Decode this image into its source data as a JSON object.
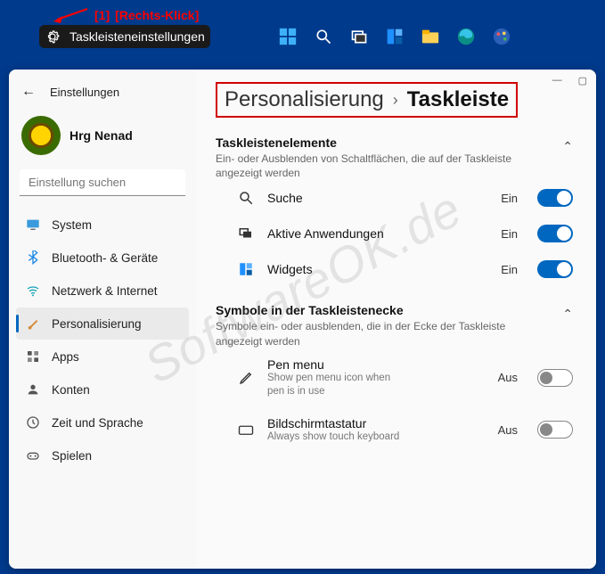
{
  "annotation": {
    "index": "[1]",
    "text": "[Rechts-Klick]"
  },
  "context_menu": {
    "label": "Taskleisteneinstellungen"
  },
  "sidebar": {
    "back_label": "Einstellungen",
    "user_name": "Hrg Nenad",
    "search_placeholder": "Einstellung suchen",
    "items": [
      {
        "label": "System"
      },
      {
        "label": "Bluetooth- & Geräte"
      },
      {
        "label": "Netzwerk & Internet"
      },
      {
        "label": "Personalisierung"
      },
      {
        "label": "Apps"
      },
      {
        "label": "Konten"
      },
      {
        "label": "Zeit und Sprache"
      },
      {
        "label": "Spielen"
      }
    ]
  },
  "breadcrumb": {
    "parent": "Personalisierung",
    "current": "Taskleiste"
  },
  "sections": [
    {
      "title": "Taskleistenelemente",
      "subtitle": "Ein- oder Ausblenden von Schaltflächen, die auf der Taskleiste angezeigt werden",
      "rows": [
        {
          "label": "Suche",
          "state": "Ein"
        },
        {
          "label": "Aktive Anwendungen",
          "state": "Ein"
        },
        {
          "label": "Widgets",
          "state": "Ein"
        }
      ]
    },
    {
      "title": "Symbole in der Taskleistenecke",
      "subtitle": "Symbole ein- oder ausblenden, die in der Ecke der Taskleiste angezeigt werden",
      "rows": [
        {
          "label": "Pen menu",
          "desc": "Show pen menu icon when pen is in use",
          "state": "Aus"
        },
        {
          "label": "Bildschirmtastatur",
          "desc": "Always show touch keyboard",
          "state": "Aus"
        }
      ]
    }
  ],
  "watermark": "SoftwareOK.de"
}
